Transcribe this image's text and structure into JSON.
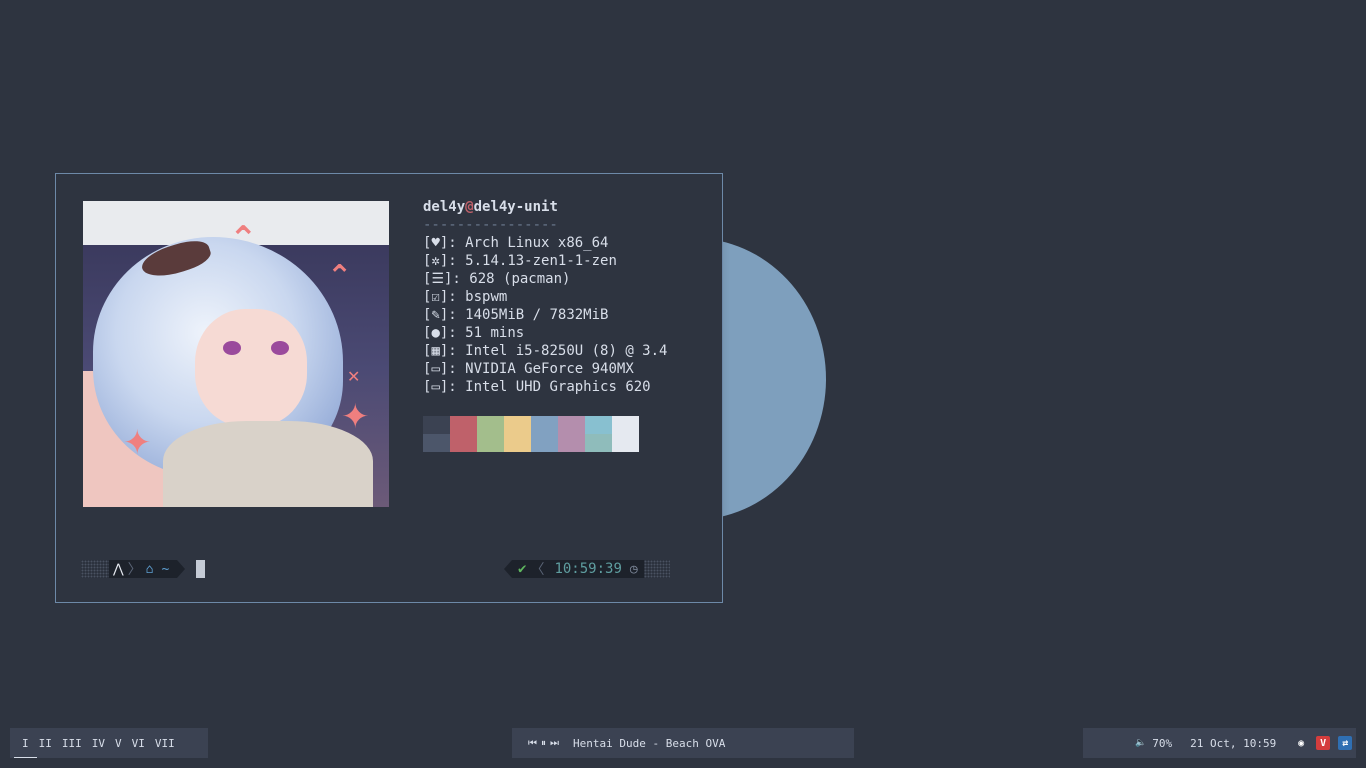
{
  "terminal": {
    "user": "del4y",
    "at": "@",
    "host": "del4y-unit",
    "separator": "----------------",
    "rows": [
      {
        "icon": "♥",
        "icon_name": "heart-icon",
        "value": "Arch Linux x86_64"
      },
      {
        "icon": "✲",
        "icon_name": "gear-icon",
        "value": "5.14.13-zen1-1-zen"
      },
      {
        "icon": "☰",
        "icon_name": "database-icon",
        "value": "628 (pacman)"
      },
      {
        "icon": "☑",
        "icon_name": "window-check-icon",
        "value": "bspwm"
      },
      {
        "icon": "✎",
        "icon_name": "leaf-icon",
        "value": "1405MiB / 7832MiB"
      },
      {
        "icon": "●",
        "icon_name": "bulb-icon",
        "value": "51 mins"
      },
      {
        "icon": "▦",
        "icon_name": "cpu-icon",
        "value": "Intel i5-8250U (8) @ 3.4"
      },
      {
        "icon": "▭",
        "icon_name": "monitor-icon",
        "value": "NVIDIA GeForce 940MX"
      },
      {
        "icon": "▭",
        "icon_name": "monitor-icon",
        "value": "Intel UHD Graphics 620"
      }
    ],
    "palette": [
      {
        "top": "#3b4252",
        "bottom": "#4c566a"
      },
      {
        "top": "#bf616a",
        "bottom": "#bf616a"
      },
      {
        "top": "#a3be8c",
        "bottom": "#a3be8c"
      },
      {
        "top": "#ebcb8b",
        "bottom": "#ebcb8b"
      },
      {
        "top": "#81a1c1",
        "bottom": "#81a1c1"
      },
      {
        "top": "#b48ead",
        "bottom": "#b48ead"
      },
      {
        "top": "#88c0d0",
        "bottom": "#8fbcbb"
      },
      {
        "top": "#e5e9f0",
        "bottom": "#e5e9f0"
      }
    ],
    "prompt": {
      "os_glyph": "⋀",
      "arrow": "〉",
      "home_glyph": "⌂",
      "dir": "~",
      "status_glyph": "✔",
      "left_arrow": "〈",
      "time": "10:59:39",
      "clock_glyph": "◷"
    }
  },
  "workspaces": [
    "I",
    "II",
    "III",
    "IV",
    "V",
    "VI",
    "VII"
  ],
  "active_workspace": "I",
  "media": {
    "prev": "⏮",
    "pause": "⏸",
    "next": "⏭",
    "title": "Hentai Dude - Beach OVA"
  },
  "status": {
    "volume_icon": "🔈",
    "volume": "70%",
    "datetime": "21 Oct, 10:59",
    "tray": [
      {
        "name": "discord-icon",
        "glyph": "◉",
        "bg": "#3b4252",
        "fg": "#ffffff"
      },
      {
        "name": "vivaldi-icon",
        "glyph": "V",
        "bg": "#d43d3d",
        "fg": "#ffffff"
      },
      {
        "name": "teamviewer-icon",
        "glyph": "⇄",
        "bg": "#2f6fb3",
        "fg": "#ffffff"
      }
    ]
  },
  "colors": {
    "background": "#2e3440",
    "border": "#6d89a8",
    "accent_red": "#bf616a"
  }
}
